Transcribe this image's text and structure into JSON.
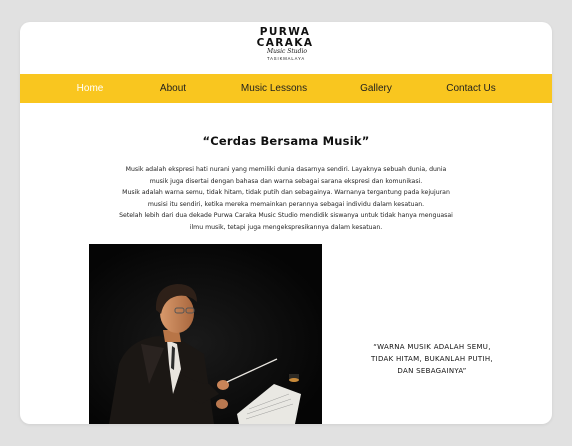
{
  "logo": {
    "line1": "PURWA",
    "line2": "CARAKA",
    "line3": "Music Studio",
    "line4": "TASIKMALAYA"
  },
  "nav": {
    "items": [
      {
        "label": "Home",
        "active": true
      },
      {
        "label": "About",
        "active": false
      },
      {
        "label": "Music Lessons",
        "active": false
      },
      {
        "label": "Gallery",
        "active": false
      },
      {
        "label": "Contact Us",
        "active": false
      }
    ]
  },
  "main": {
    "heading": "“Cerdas Bersama Musik”",
    "paragraph_lines": [
      "Musik adalah ekspresi hati nurani yang memiliki dunia dasarnya sendiri. Layaknya sebuah dunia, dunia",
      "musik juga disertai dengan bahasa dan warna sebagai sarana ekspresi dan komunikasi.",
      "Musik adalah warna semu, tidak hitam, tidak putih dan sebagainya. Warnanya tergantung pada kejujuran",
      "musisi itu sendiri, ketika mereka memainkan perannya sebagai individu dalam kesatuan.",
      "Setelah lebih dari dua dekade Purwa Caraka Music Studio mendidik siswanya untuk tidak hanya menguasai",
      "ilmu musik, tetapi juga mengekspresikannya dalam kesatuan."
    ],
    "quote_lines": [
      "“WARNA MUSIK ADALAH SEMU,",
      "TIDAK HITAM, BUKANLAH PUTIH,",
      "DAN SEBAGAINYA”"
    ]
  },
  "colors": {
    "nav_bg": "#f9c61f",
    "page_bg": "#e1e1e1",
    "card_bg": "#ffffff",
    "nav_active_text": "#ffffff",
    "nav_text": "#1f1f1f"
  }
}
